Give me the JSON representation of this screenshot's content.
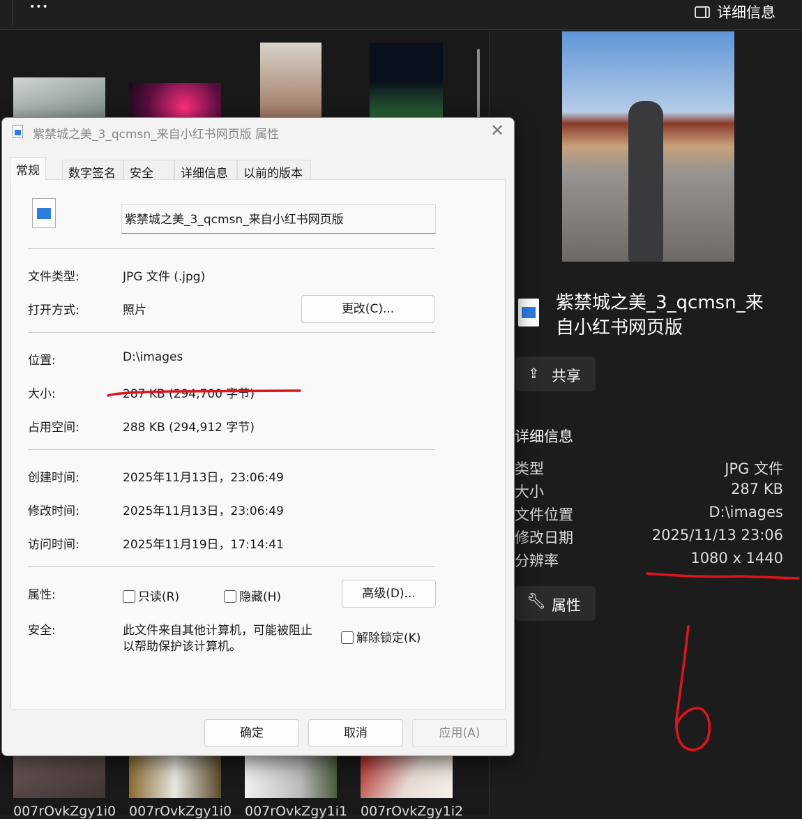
{
  "topbar": {
    "more_label": "•••",
    "details_toggle": "详细信息"
  },
  "gallery": {
    "captions": [
      "007rOvkZgy1i0",
      "007rOvkZgy1i0",
      "007rOvkZgy1i1",
      "007rOvkZgy1i2"
    ]
  },
  "dialog": {
    "title": "紫禁城之美_3_qcmsn_来自小红书网页版 属性",
    "tabs": [
      "常规",
      "数字签名",
      "安全",
      "详细信息",
      "以前的版本"
    ],
    "filename": "紫禁城之美_3_qcmsn_来自小红书网页版",
    "rows": {
      "type_label": "文件类型:",
      "type_value": "JPG 文件 (.jpg)",
      "open_label": "打开方式:",
      "open_value": "照片",
      "change_button": "更改(C)...",
      "location_label": "位置:",
      "location_value": "D:\\images",
      "size_label": "大小:",
      "size_value": "287 KB (294,700 字节)",
      "disk_label": "占用空间:",
      "disk_value": "288 KB (294,912 字节)",
      "created_label": "创建时间:",
      "created_value": "2025年11月13日，23:06:49",
      "modified_label": "修改时间:",
      "modified_value": "2025年11月13日，23:06:49",
      "accessed_label": "访问时间:",
      "accessed_value": "2025年11月19日，17:14:41",
      "attr_label": "属性:",
      "readonly": "只读(R)",
      "hidden": "隐藏(H)",
      "advanced_button": "高级(D)...",
      "security_label": "安全:",
      "security_text1": "此文件来自其他计算机，可能被阻止",
      "security_text2": "以帮助保护该计算机。",
      "unblock": "解除锁定(K)"
    },
    "buttons": {
      "ok": "确定",
      "cancel": "取消",
      "apply": "应用(A)"
    }
  },
  "pane": {
    "title_line1": "紫禁城之美_3_qcmsn_来",
    "title_line2": "自小红书网页版",
    "share": "共享",
    "details_header": "详细信息",
    "details": [
      {
        "label": "类型",
        "value": "JPG 文件"
      },
      {
        "label": "大小",
        "value": "287 KB"
      },
      {
        "label": "文件位置",
        "value": "D:\\images"
      },
      {
        "label": "修改日期",
        "value": "2025/11/13 23:06"
      },
      {
        "label": "分辨率",
        "value": "1080 x 1440"
      }
    ],
    "properties": "属性"
  },
  "annotation": {
    "handwritten": "6",
    "color": "#e0141e"
  }
}
